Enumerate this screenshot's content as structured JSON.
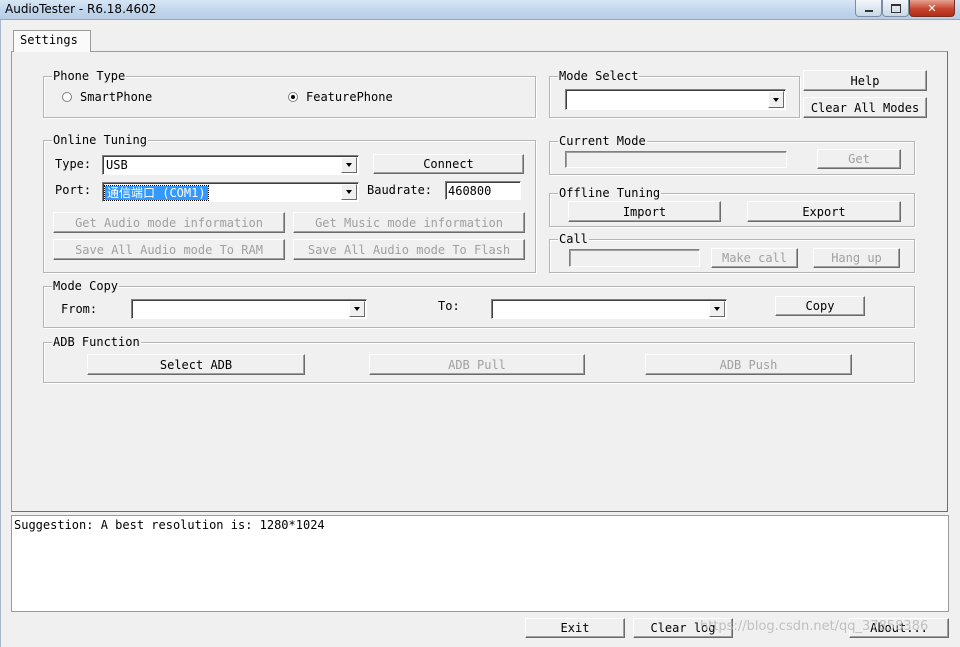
{
  "window": {
    "title": "AudioTester - R6.18.4602"
  },
  "tabs": [
    {
      "label": "Settings"
    }
  ],
  "phone_type": {
    "legend": "Phone Type",
    "options": [
      {
        "label": "SmartPhone",
        "selected": false
      },
      {
        "label": "FeaturePhone",
        "selected": true
      }
    ]
  },
  "mode_select": {
    "legend": "Mode Select",
    "value": ""
  },
  "help_button": "Help",
  "clear_all_modes_button": "Clear All Modes",
  "online_tuning": {
    "legend": "Online Tuning",
    "type_label": "Type:",
    "type_value": "USB",
    "connect_button": "Connect",
    "port_label": "Port:",
    "port_value": "通信端口 (COM1)",
    "baudrate_label": "Baudrate:",
    "baudrate_value": "460800",
    "get_audio_button": "Get Audio mode information",
    "get_music_button": "Get Music mode information",
    "save_ram_button": "Save All Audio mode To RAM",
    "save_flash_button": "Save All Audio mode To Flash"
  },
  "current_mode": {
    "legend": "Current Mode",
    "value": "",
    "get_button": "Get"
  },
  "offline_tuning": {
    "legend": "Offline Tuning",
    "import_button": "Import",
    "export_button": "Export"
  },
  "call": {
    "legend": "Call",
    "value": "",
    "make_call_button": "Make call",
    "hang_up_button": "Hang up"
  },
  "mode_copy": {
    "legend": "Mode Copy",
    "from_label": "From:",
    "from_value": "",
    "to_label": "To:",
    "to_value": "",
    "copy_button": "Copy"
  },
  "adb": {
    "legend": "ADB Function",
    "select_button": "Select ADB",
    "pull_button": "ADB Pull",
    "push_button": "ADB Push"
  },
  "log": {
    "text": "Suggestion: A best resolution is: 1280*1024"
  },
  "bottom": {
    "exit_button": "Exit",
    "clear_log_button": "Clear log",
    "about_button": "About..."
  },
  "watermark": "https://blog.csdn.net/qq_37858386"
}
